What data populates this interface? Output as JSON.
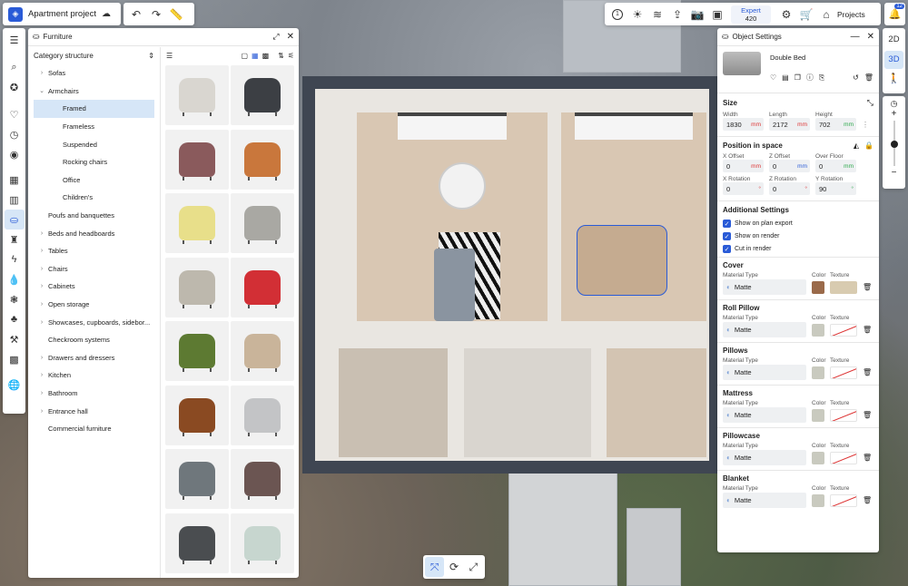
{
  "topbar": {
    "project_name": "Apartment project",
    "expert_label": "Expert",
    "expert_count": "420",
    "projects_label": "Projects",
    "notifications_count": "12",
    "help_label": "1"
  },
  "view_toggle": {
    "two_d": "2D",
    "three_d": "3D"
  },
  "furniture_panel": {
    "title": "Furniture",
    "category_header": "Category structure",
    "categories": [
      {
        "label": "Sofas",
        "expand": "›",
        "level": 1
      },
      {
        "label": "Armchairs",
        "expand": "⌄",
        "level": 1
      },
      {
        "label": "Framed",
        "expand": "",
        "level": 2,
        "selected": true
      },
      {
        "label": "Frameless",
        "expand": "",
        "level": 2
      },
      {
        "label": "Suspended",
        "expand": "",
        "level": 2
      },
      {
        "label": "Rocking chairs",
        "expand": "",
        "level": 2
      },
      {
        "label": "Office",
        "expand": "",
        "level": 2
      },
      {
        "label": "Children's",
        "expand": "",
        "level": 2
      },
      {
        "label": "Poufs and banquettes",
        "expand": "",
        "level": 1
      },
      {
        "label": "Beds and headboards",
        "expand": "›",
        "level": 1
      },
      {
        "label": "Tables",
        "expand": "›",
        "level": 1
      },
      {
        "label": "Chairs",
        "expand": "›",
        "level": 1
      },
      {
        "label": "Cabinets",
        "expand": "›",
        "level": 1
      },
      {
        "label": "Open storage",
        "expand": "›",
        "level": 1
      },
      {
        "label": "Showcases, cupboards, sidebor...",
        "expand": "›",
        "level": 1
      },
      {
        "label": "Checkroom systems",
        "expand": "",
        "level": 1
      },
      {
        "label": "Drawers and dressers",
        "expand": "›",
        "level": 1
      },
      {
        "label": "Kitchen",
        "expand": "›",
        "level": 1
      },
      {
        "label": "Bathroom",
        "expand": "›",
        "level": 1
      },
      {
        "label": "Entrance hall",
        "expand": "›",
        "level": 1
      },
      {
        "label": "Commercial furniture",
        "expand": "",
        "level": 1
      }
    ],
    "thumbnail_colors": [
      "#d9d6d0",
      "#3c3f44",
      "#8a5a5c",
      "#c9773c",
      "#e8df8a",
      "#a9a8a3",
      "#bdb8ad",
      "#d22f35",
      "#5d7a32",
      "#c9b49a",
      "#8a4a22",
      "#c3c4c6",
      "#6f777c",
      "#6b5552",
      "#4a4d50",
      "#c7d6cf"
    ]
  },
  "object_settings": {
    "title": "Object Settings",
    "object_name": "Double Bed",
    "size_title": "Size",
    "width_label": "Width",
    "width_value": "1830",
    "width_unit": "mm",
    "length_label": "Length",
    "length_value": "2172",
    "length_unit": "mm",
    "height_label": "Height",
    "height_value": "702",
    "height_unit": "mm",
    "position_title": "Position in space",
    "x_offset_label": "X Offset",
    "x_offset_value": "0",
    "x_offset_unit": "mm",
    "z_offset_label": "Z Offset",
    "z_offset_value": "0",
    "z_offset_unit": "mm",
    "over_floor_label": "Over Floor",
    "over_floor_value": "0",
    "over_floor_unit": "mm",
    "x_rotation_label": "X Rotation",
    "x_rotation_value": "0",
    "x_rotation_unit": "°",
    "z_rotation_label": "Z Rotation",
    "z_rotation_value": "0",
    "z_rotation_unit": "°",
    "y_rotation_label": "Y Rotation",
    "y_rotation_value": "90",
    "y_rotation_unit": "°",
    "additional_title": "Additional Settings",
    "show_on_plan_export": "Show on plan export",
    "show_on_render": "Show on render",
    "cut_in_render": "Cut in render",
    "material_type_label": "Material Type",
    "color_label": "Color",
    "texture_label": "Texture",
    "materials": [
      {
        "name": "Cover",
        "type": "Matte",
        "color": "#9a6a4a",
        "textured": true
      },
      {
        "name": "Roll Pillow",
        "type": "Matte",
        "color": "#c9cabf",
        "textured": false
      },
      {
        "name": "Pillows",
        "type": "Matte",
        "color": "#c9cabf",
        "textured": false
      },
      {
        "name": "Mattress",
        "type": "Matte",
        "color": "#c9cabf",
        "textured": false
      },
      {
        "name": "Pillowcase",
        "type": "Matte",
        "color": "#c9cabf",
        "textured": false
      },
      {
        "name": "Blanket",
        "type": "Matte",
        "color": "#c9cabf",
        "textured": false
      }
    ]
  },
  "colors": {
    "accent": "#2a5bd7",
    "selected_row": "#d6e6f7",
    "unit_red": "#d33"
  }
}
